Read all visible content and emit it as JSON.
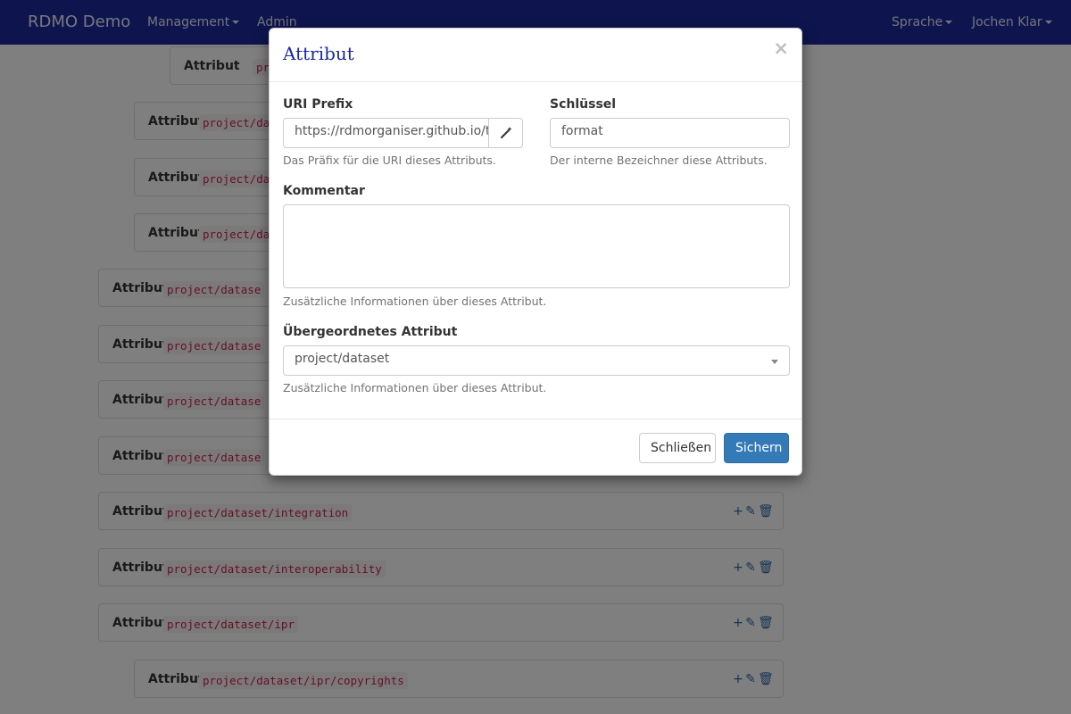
{
  "navbar": {
    "brand": "RDMO Demo",
    "management": "Management",
    "admin": "Admin",
    "language": "Sprache",
    "user": "Jochen Klar"
  },
  "list": {
    "row_label": "Attribut",
    "rows": [
      {
        "key": "proj"
      },
      {
        "key": "project/da"
      },
      {
        "key": "project/da"
      },
      {
        "key": "project/da"
      },
      {
        "key": "project/datase"
      },
      {
        "key": "project/datase"
      },
      {
        "key": "project/datase"
      },
      {
        "key": "project/datase"
      },
      {
        "key": "project/dataset/integration"
      },
      {
        "key": "project/dataset/interoperability"
      },
      {
        "key": "project/dataset/ipr"
      },
      {
        "key": "project/dataset/ipr/copyrights"
      }
    ]
  },
  "modal": {
    "title": "Attribut",
    "close_symbol": "×",
    "uri_prefix": {
      "label": "URI Prefix",
      "value": "https://rdmorganiser.github.io/terms",
      "help": "Das Präfix für die URI dieses Attributs."
    },
    "key": {
      "label": "Schlüssel",
      "value": "format",
      "help": "Der interne Bezeichner diese Attributs."
    },
    "comment": {
      "label": "Kommentar",
      "value": "",
      "help": "Zusätzliche Informationen über dieses Attribut."
    },
    "parent": {
      "label": "Übergeordnetes Attribut",
      "value": "project/dataset",
      "help": "Zusätzliche Informationen über dieses Attribut."
    },
    "close_button": "Schließen",
    "save_button": "Sichern"
  },
  "colors": {
    "navbar": "#1c2a9c",
    "primary": "#337ab7",
    "code_text": "#c7254e",
    "action_icons": "#2c6aa8"
  }
}
